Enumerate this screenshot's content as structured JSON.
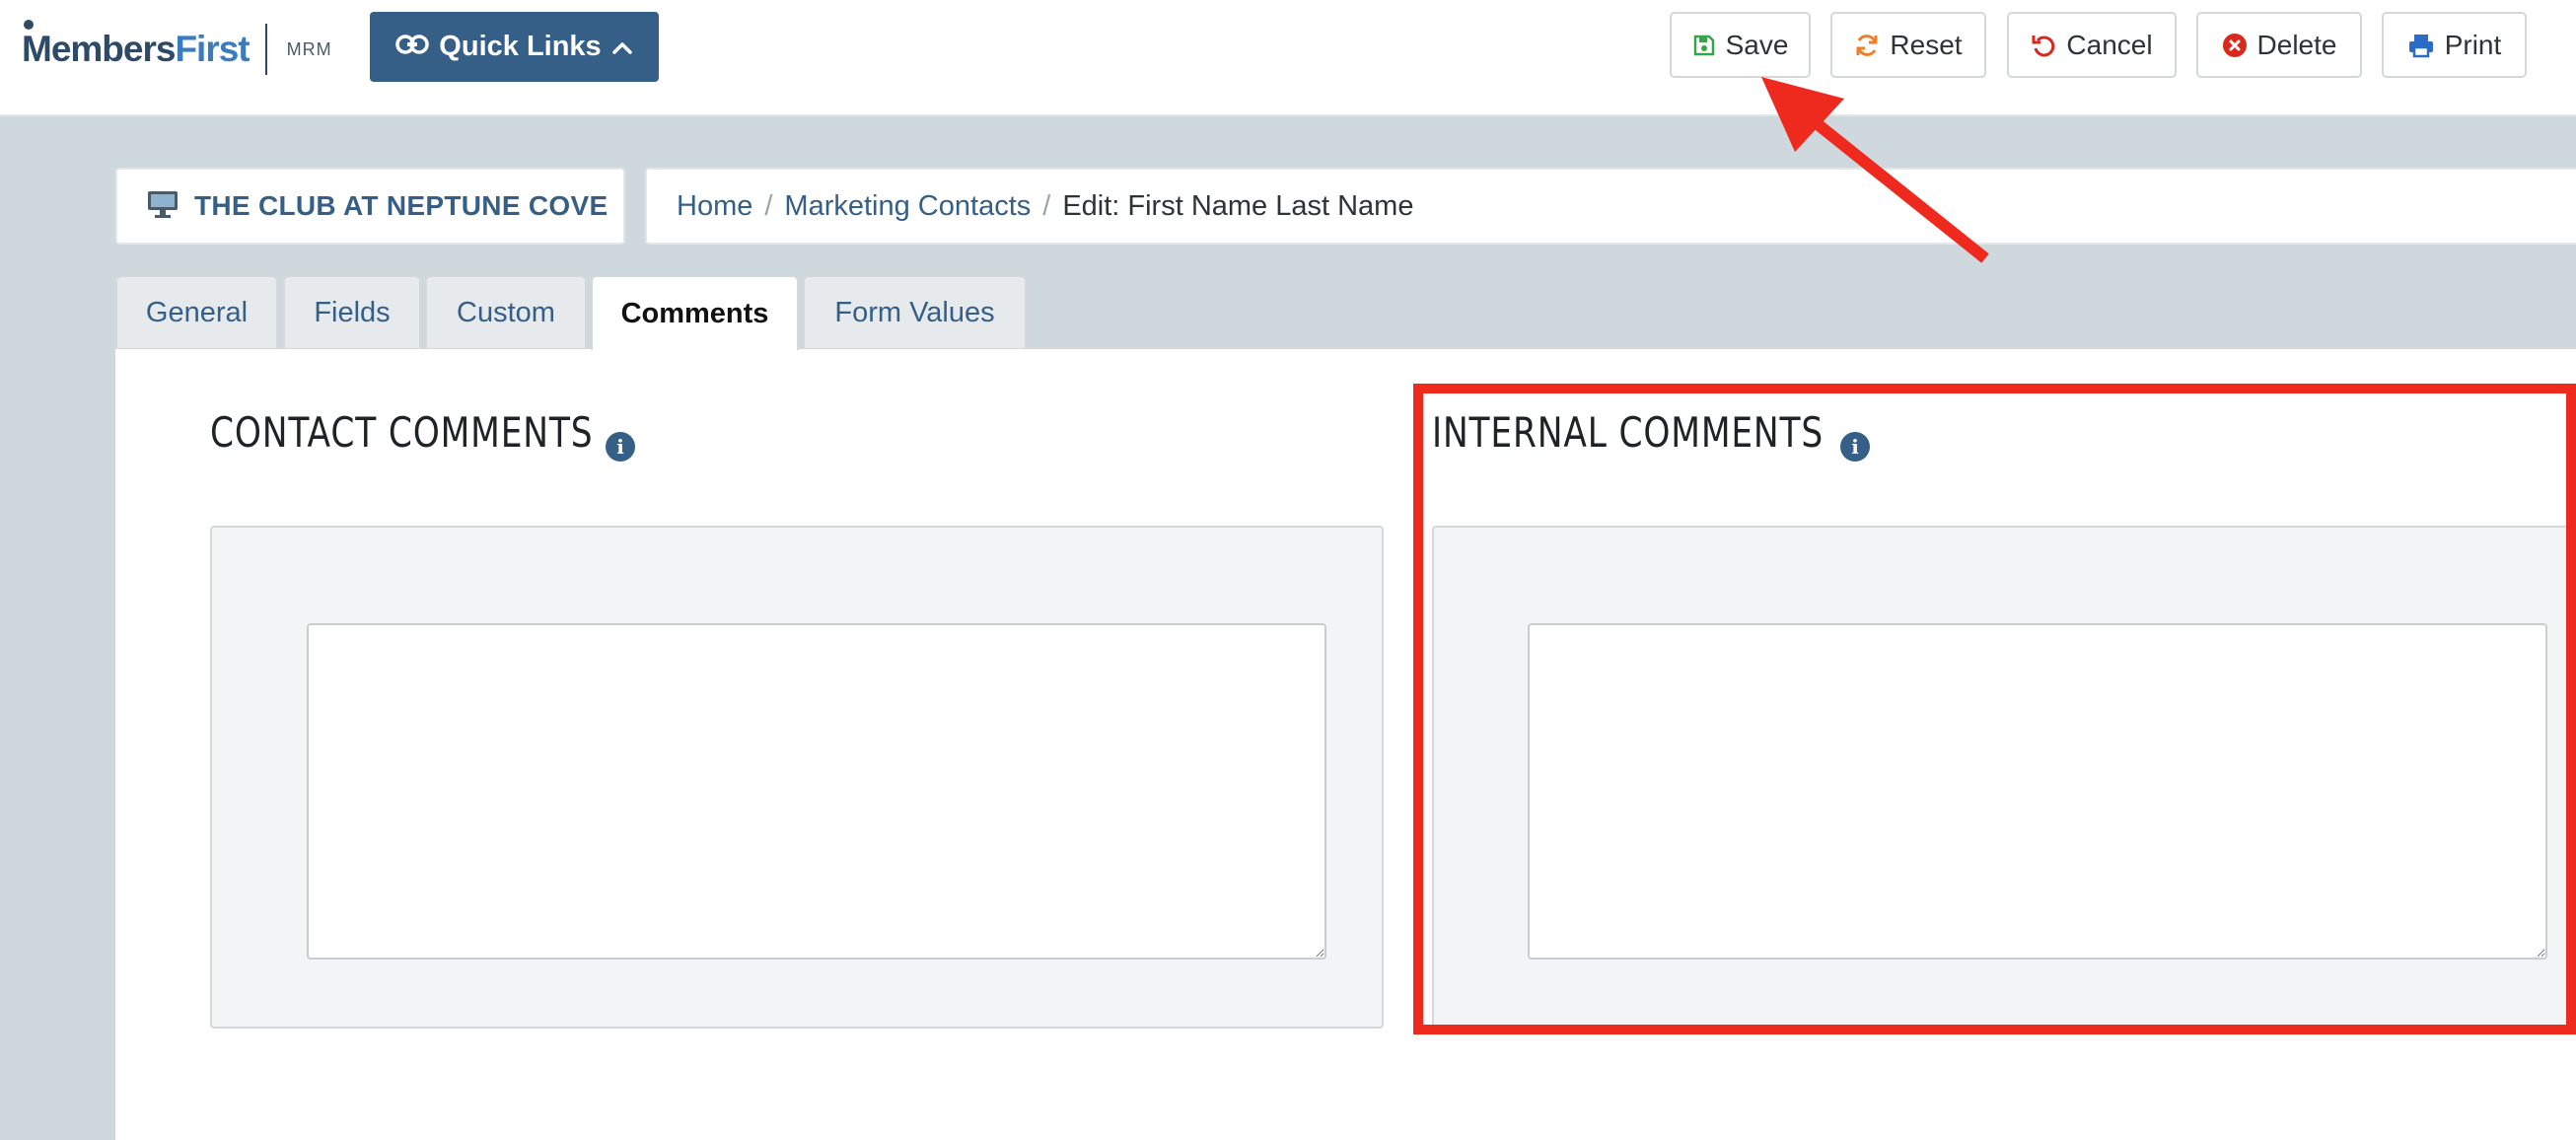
{
  "header": {
    "logo_members": "Members",
    "logo_first": "First",
    "logo_suffix": "MRM",
    "quick_links_label": "Quick Links",
    "toolbar": {
      "save_label": "Save",
      "reset_label": "Reset",
      "cancel_label": "Cancel",
      "delete_label": "Delete",
      "print_label": "Print"
    }
  },
  "club": {
    "name": "THE CLUB AT NEPTUNE COVE"
  },
  "breadcrumb": {
    "home": "Home",
    "marketing_contacts": "Marketing Contacts",
    "current": "Edit: First Name Last Name",
    "separator": "/"
  },
  "tabs": [
    {
      "label": "General"
    },
    {
      "label": "Fields"
    },
    {
      "label": "Custom"
    },
    {
      "label": "Comments"
    },
    {
      "label": "Form Values"
    }
  ],
  "active_tab": "Comments",
  "sections": {
    "contact_comments": {
      "title": "CONTACT COMMENTS",
      "value": ""
    },
    "internal_comments": {
      "title": "INTERNAL COMMENTS",
      "value": ""
    }
  },
  "colors": {
    "brand": "#355f87",
    "annotation": "#ee2a1f",
    "save_icon": "#3aa24a",
    "reset_icon": "#f07d2a",
    "cancel_icon": "#d9281c",
    "delete_icon": "#d9281c",
    "print_icon": "#2d6cc4"
  },
  "icons": [
    "link-icon",
    "chevron-up-icon",
    "save-icon",
    "reset-icon",
    "undo-icon",
    "delete-icon",
    "print-icon",
    "monitor-icon",
    "info-icon",
    "arrow-annotation",
    "highlight-annotation"
  ]
}
